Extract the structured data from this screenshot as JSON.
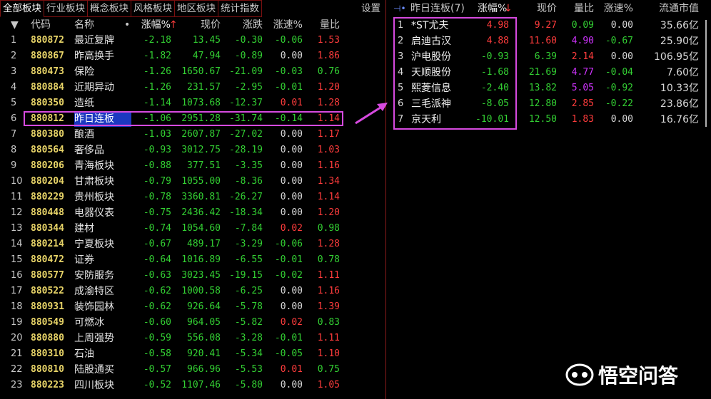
{
  "tabs": [
    "全部板块",
    "行业板块",
    "概念板块",
    "风格板块",
    "地区板块",
    "统计指数"
  ],
  "settings_label": "设置",
  "left_header": {
    "sort_glyph": "▼",
    "code": "代码",
    "name": "名称",
    "dot": "•",
    "chg": "涨幅%",
    "sort_arrow": "↑",
    "price": "现价",
    "updown": "涨跌",
    "speed": "涨速%",
    "ratio": "量比"
  },
  "left_rows": [
    {
      "idx": "1",
      "code": "880872",
      "name": "最近复牌",
      "chg": "-2.18",
      "price": "13.45",
      "updn": "-0.30",
      "speed": "-0.06",
      "ratio": "1.53",
      "speed_c": "green",
      "ratio_c": "red"
    },
    {
      "idx": "2",
      "code": "880867",
      "name": "昨高换手",
      "chg": "-1.82",
      "price": "47.94",
      "updn": "-0.89",
      "speed": "0.00",
      "ratio": "1.86",
      "speed_c": "white",
      "ratio_c": "red"
    },
    {
      "idx": "3",
      "code": "880473",
      "name": "保险",
      "chg": "-1.26",
      "price": "1650.67",
      "updn": "-21.09",
      "speed": "-0.03",
      "ratio": "0.76",
      "speed_c": "green",
      "ratio_c": "green"
    },
    {
      "idx": "4",
      "code": "880884",
      "name": "近期异动",
      "chg": "-1.26",
      "price": "231.57",
      "updn": "-2.95",
      "speed": "-0.01",
      "ratio": "1.20",
      "speed_c": "green",
      "ratio_c": "red"
    },
    {
      "idx": "5",
      "code": "880350",
      "name": "造纸",
      "chg": "-1.14",
      "price": "1073.68",
      "updn": "-12.37",
      "speed": "0.01",
      "ratio": "1.28",
      "speed_c": "red",
      "ratio_c": "red"
    },
    {
      "idx": "6",
      "code": "880812",
      "name": "昨日连板",
      "chg": "-1.06",
      "price": "2951.28",
      "updn": "-31.74",
      "speed": "-0.14",
      "ratio": "1.14",
      "speed_c": "green",
      "ratio_c": "red"
    },
    {
      "idx": "7",
      "code": "880380",
      "name": "酿酒",
      "chg": "-1.03",
      "price": "2607.87",
      "updn": "-27.02",
      "speed": "0.00",
      "ratio": "1.17",
      "speed_c": "white",
      "ratio_c": "red"
    },
    {
      "idx": "8",
      "code": "880564",
      "name": "奢侈品",
      "chg": "-0.93",
      "price": "3012.75",
      "updn": "-28.19",
      "speed": "0.00",
      "ratio": "1.03",
      "speed_c": "white",
      "ratio_c": "red"
    },
    {
      "idx": "9",
      "code": "880206",
      "name": "青海板块",
      "chg": "-0.88",
      "price": "377.51",
      "updn": "-3.35",
      "speed": "0.00",
      "ratio": "1.16",
      "speed_c": "white",
      "ratio_c": "red"
    },
    {
      "idx": "10",
      "code": "880204",
      "name": "甘肃板块",
      "chg": "-0.79",
      "price": "1055.00",
      "updn": "-8.36",
      "speed": "0.00",
      "ratio": "1.34",
      "speed_c": "white",
      "ratio_c": "red"
    },
    {
      "idx": "11",
      "code": "880229",
      "name": "贵州板块",
      "chg": "-0.78",
      "price": "3360.81",
      "updn": "-26.27",
      "speed": "0.00",
      "ratio": "1.14",
      "speed_c": "white",
      "ratio_c": "red"
    },
    {
      "idx": "12",
      "code": "880448",
      "name": "电器仪表",
      "chg": "-0.75",
      "price": "2436.42",
      "updn": "-18.34",
      "speed": "0.00",
      "ratio": "1.20",
      "speed_c": "white",
      "ratio_c": "red"
    },
    {
      "idx": "13",
      "code": "880344",
      "name": "建材",
      "chg": "-0.74",
      "price": "1054.60",
      "updn": "-7.84",
      "speed": "0.02",
      "ratio": "0.98",
      "speed_c": "red",
      "ratio_c": "green"
    },
    {
      "idx": "14",
      "code": "880214",
      "name": "宁夏板块",
      "chg": "-0.67",
      "price": "489.17",
      "updn": "-3.29",
      "speed": "-0.06",
      "ratio": "1.28",
      "speed_c": "green",
      "ratio_c": "red"
    },
    {
      "idx": "15",
      "code": "880472",
      "name": "证券",
      "chg": "-0.64",
      "price": "1016.89",
      "updn": "-6.55",
      "speed": "-0.01",
      "ratio": "0.78",
      "speed_c": "green",
      "ratio_c": "green"
    },
    {
      "idx": "16",
      "code": "880577",
      "name": "安防服务",
      "chg": "-0.63",
      "price": "3023.45",
      "updn": "-19.15",
      "speed": "-0.02",
      "ratio": "1.11",
      "speed_c": "green",
      "ratio_c": "red"
    },
    {
      "idx": "17",
      "code": "880522",
      "name": "成渝特区",
      "chg": "-0.62",
      "price": "1000.58",
      "updn": "-6.25",
      "speed": "0.00",
      "ratio": "1.16",
      "speed_c": "white",
      "ratio_c": "red"
    },
    {
      "idx": "18",
      "code": "880931",
      "name": "装饰园林",
      "chg": "-0.62",
      "price": "926.64",
      "updn": "-5.78",
      "speed": "0.00",
      "ratio": "1.39",
      "speed_c": "white",
      "ratio_c": "red"
    },
    {
      "idx": "19",
      "code": "880549",
      "name": "可燃冰",
      "chg": "-0.60",
      "price": "964.05",
      "updn": "-5.82",
      "speed": "0.02",
      "ratio": "0.83",
      "speed_c": "red",
      "ratio_c": "green"
    },
    {
      "idx": "20",
      "code": "880880",
      "name": "上周强势",
      "chg": "-0.59",
      "price": "556.08",
      "updn": "-3.28",
      "speed": "-0.01",
      "ratio": "1.11",
      "speed_c": "green",
      "ratio_c": "red"
    },
    {
      "idx": "21",
      "code": "880310",
      "name": "石油",
      "chg": "-0.58",
      "price": "920.41",
      "updn": "-5.34",
      "speed": "-0.05",
      "ratio": "1.10",
      "speed_c": "green",
      "ratio_c": "red"
    },
    {
      "idx": "22",
      "code": "880810",
      "name": "陆股通买",
      "chg": "-0.57",
      "price": "966.96",
      "updn": "-5.53",
      "speed": "0.01",
      "ratio": "0.75",
      "speed_c": "red",
      "ratio_c": "green"
    },
    {
      "idx": "23",
      "code": "880223",
      "name": "四川板块",
      "chg": "-0.52",
      "price": "1107.46",
      "updn": "-5.80",
      "speed": "0.00",
      "ratio": "1.05",
      "speed_c": "white",
      "ratio_c": "red"
    }
  ],
  "right_header": {
    "pin": "⊣•",
    "title": "昨日连板(7)",
    "chg": "涨幅%",
    "sort_arrow": "↓",
    "price": "现价",
    "ratio": "量比",
    "speed": "涨速%",
    "cap": "流通市值"
  },
  "right_rows": [
    {
      "idx": "1",
      "name": "*ST尤夫",
      "chg": "4.98",
      "price": "9.27",
      "ratio": "0.09",
      "speed": "0.00",
      "cap": "35.66亿",
      "chg_c": "red",
      "price_c": "red",
      "ratio_c": "green",
      "speed_c": "white"
    },
    {
      "idx": "2",
      "name": "启迪古汉",
      "chg": "4.88",
      "price": "11.60",
      "ratio": "4.90",
      "speed": "-0.67",
      "cap": "25.90亿",
      "chg_c": "red",
      "price_c": "red",
      "ratio_c": "magenta",
      "speed_c": "green"
    },
    {
      "idx": "3",
      "name": "沪电股份",
      "chg": "-0.93",
      "price": "6.39",
      "ratio": "2.14",
      "speed": "0.00",
      "cap": "106.95亿",
      "chg_c": "green",
      "price_c": "green",
      "ratio_c": "red",
      "speed_c": "white"
    },
    {
      "idx": "4",
      "name": "天顺股份",
      "chg": "-1.68",
      "price": "21.69",
      "ratio": "4.77",
      "speed": "-0.04",
      "cap": "7.60亿",
      "chg_c": "green",
      "price_c": "green",
      "ratio_c": "magenta",
      "speed_c": "green"
    },
    {
      "idx": "5",
      "name": "熙菱信息",
      "chg": "-2.40",
      "price": "13.82",
      "ratio": "5.05",
      "speed": "-0.92",
      "cap": "10.33亿",
      "chg_c": "green",
      "price_c": "green",
      "ratio_c": "magenta",
      "speed_c": "green"
    },
    {
      "idx": "6",
      "name": "三毛派神",
      "chg": "-8.05",
      "price": "12.80",
      "ratio": "2.85",
      "speed": "-0.22",
      "cap": "23.86亿",
      "chg_c": "green",
      "price_c": "green",
      "ratio_c": "red",
      "speed_c": "green"
    },
    {
      "idx": "7",
      "name": "京天利",
      "chg": "-10.01",
      "price": "12.50",
      "ratio": "1.83",
      "speed": "0.00",
      "cap": "16.76亿",
      "chg_c": "green",
      "price_c": "green",
      "ratio_c": "red",
      "speed_c": "white"
    }
  ],
  "watermark": "悟空问答",
  "colors": {
    "up": "#ff3c3c",
    "down": "#33d033",
    "flat": "#d8d8d8",
    "highlight": "#d64adf",
    "selection": "#1c38c0"
  }
}
